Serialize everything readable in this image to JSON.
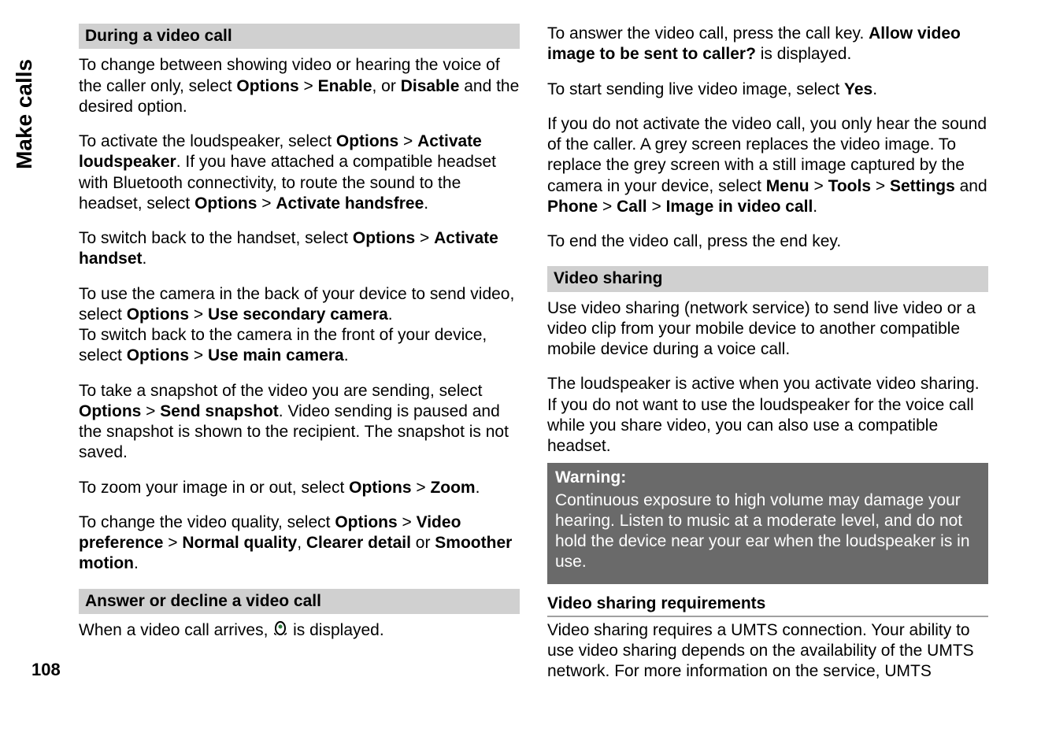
{
  "sidebar": {
    "label": "Make calls"
  },
  "pageNumber": "108",
  "left": {
    "h1": "During a video call",
    "p1a": "To change between showing video or hearing the voice of the caller only, select ",
    "p1b": "Options",
    "p1c": " > ",
    "p1d": "Enable",
    "p1e": ", or ",
    "p1f": "Disable",
    "p1g": " and the desired option.",
    "p2a": "To activate the loudspeaker, select ",
    "p2b": "Options",
    "p2c": " > ",
    "p2d": "Activate loudspeaker",
    "p2e": ". If you have attached a compatible headset with Bluetooth connectivity, to route the sound to the headset, select ",
    "p2f": "Options",
    "p2g": " > ",
    "p2h": "Activate handsfree",
    "p2i": ".",
    "p3a": "To switch back to the handset, select ",
    "p3b": "Options",
    "p3c": " > ",
    "p3d": "Activate handset",
    "p3e": ".",
    "p4a": "To use the camera in the back of your device to send video, select ",
    "p4b": "Options",
    "p4c": " > ",
    "p4d": "Use secondary camera",
    "p4e": ".",
    "p5a": "To switch back to the camera in the front of your device, select ",
    "p5b": "Options",
    "p5c": " > ",
    "p5d": "Use main camera",
    "p5e": ".",
    "p6a": "To take a snapshot of the video you are sending, select ",
    "p6b": "Options",
    "p6c": " > ",
    "p6d": "Send snapshot",
    "p6e": ". Video sending is paused and the snapshot is shown to the recipient. The snapshot is not saved.",
    "p7a": "To zoom your image in or out, select ",
    "p7b": "Options",
    "p7c": " > ",
    "p7d": "Zoom",
    "p7e": ".",
    "p8a": "To change the video quality, select ",
    "p8b": "Options",
    "p8c": " > ",
    "p8d": "Video preference",
    "p8e": " > ",
    "p8f": "Normal quality",
    "p8g": ", ",
    "p8h": "Clearer detail",
    "p8i": " or ",
    "p8j": "Smoother motion",
    "p8k": ".",
    "h2": "Answer or decline a video call",
    "p9a": "When a video call arrives, ",
    "p9b": " is displayed."
  },
  "right": {
    "p1a": "To answer the video call, press the call key. ",
    "p1b": "Allow video image to be sent to caller?",
    "p1c": " is displayed.",
    "p2a": "To start sending live video image, select ",
    "p2b": "Yes",
    "p2c": ".",
    "p3a": "If you do not activate the video call, you only hear the sound of the caller. A grey screen replaces the video image. To replace the grey screen with a still image captured by the camera in your device, select ",
    "p3b": "Menu",
    "p3c": " > ",
    "p3d": "Tools",
    "p3e": " > ",
    "p3f": "Settings",
    "p3g": " and ",
    "p3h": "Phone",
    "p3i": " > ",
    "p3j": "Call",
    "p3k": " > ",
    "p3l": "Image in video call",
    "p3m": ".",
    "p4": "To end the video call, press the end key.",
    "h1": "Video sharing",
    "p5": "Use video sharing (network service) to send live video or a video clip from your mobile device to another compatible mobile device during a voice call.",
    "p6": "The loudspeaker is active when you activate video sharing. If you do not want to use the loudspeaker for the voice call while you share video, you can also use a compatible headset.",
    "warnTitle": "Warning:",
    "warnBody": "Continuous exposure to high volume may damage your hearing. Listen to music at a moderate level, and do not hold the device near your ear when the loudspeaker is in use.",
    "h2": "Video sharing requirements",
    "p7": "Video sharing requires a UMTS connection. Your ability to use video sharing depends on the availability of the UMTS network. For more information on the service, UMTS"
  }
}
